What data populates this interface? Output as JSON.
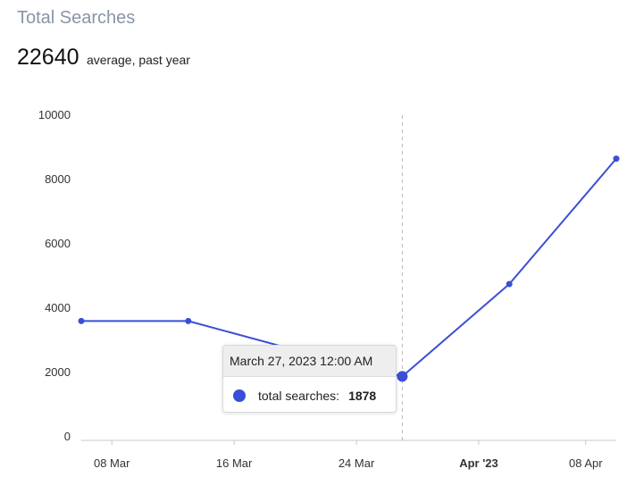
{
  "header": {
    "title": "Total Searches",
    "summary_value": "22640",
    "summary_label": "average, past year"
  },
  "colors": {
    "series": "#3a4fd6",
    "grid": "#b8b8b8"
  },
  "chart_data": {
    "type": "line",
    "title": "",
    "xlabel": "",
    "ylabel": "",
    "ylim": [
      0,
      10000
    ],
    "yticks": [
      "0",
      "2000",
      "4000",
      "6000",
      "8000",
      "10000"
    ],
    "xticks": [
      {
        "label": "08 Mar",
        "date": "2023-03-08",
        "bold": false
      },
      {
        "label": "16 Mar",
        "date": "2023-03-16",
        "bold": false
      },
      {
        "label": "24 Mar",
        "date": "2023-03-24",
        "bold": false
      },
      {
        "label": "Apr '23",
        "date": "2023-04-01",
        "bold": true
      },
      {
        "label": "08 Apr",
        "date": "2023-04-08",
        "bold": false
      }
    ],
    "xlim": [
      "2023-03-06",
      "2023-04-10"
    ],
    "series": [
      {
        "name": "total searches",
        "points": [
          {
            "x": "2023-03-06",
            "y": 3600
          },
          {
            "x": "2023-03-13",
            "y": 3600
          },
          {
            "x": "2023-03-20",
            "y": 2700
          },
          {
            "x": "2023-03-27",
            "y": 1878
          },
          {
            "x": "2023-04-03",
            "y": 4750
          },
          {
            "x": "2023-04-10",
            "y": 8650
          }
        ]
      }
    ],
    "highlight_index": 3
  },
  "tooltip": {
    "date": "March 27, 2023 12:00 AM",
    "label": "total searches:",
    "value": "1878"
  }
}
